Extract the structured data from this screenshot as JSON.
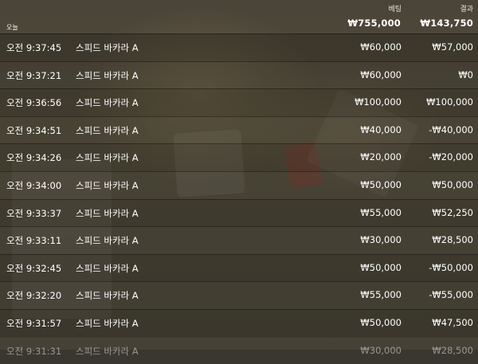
{
  "header": {
    "bet_label": "베팅",
    "result_label": "결과",
    "section_label": "오늘",
    "total_bet": "₩755,000",
    "total_result": "₩143,750"
  },
  "rows": [
    {
      "time": "오전 9:37:45",
      "game": "스피드 바카라 A",
      "bet": "₩60,000",
      "result": "₩57,000"
    },
    {
      "time": "오전 9:37:21",
      "game": "스피드 바카라 A",
      "bet": "₩60,000",
      "result": "₩0"
    },
    {
      "time": "오전 9:36:56",
      "game": "스피드 바카라 A",
      "bet": "₩100,000",
      "result": "₩100,000"
    },
    {
      "time": "오전 9:34:51",
      "game": "스피드 바카라 A",
      "bet": "₩40,000",
      "result": "-₩40,000"
    },
    {
      "time": "오전 9:34:26",
      "game": "스피드 바카라 A",
      "bet": "₩20,000",
      "result": "-₩20,000"
    },
    {
      "time": "오전 9:34:00",
      "game": "스피드 바카라 A",
      "bet": "₩50,000",
      "result": "₩50,000"
    },
    {
      "time": "오전 9:33:37",
      "game": "스피드 바카라 A",
      "bet": "₩55,000",
      "result": "₩52,250"
    },
    {
      "time": "오전 9:33:11",
      "game": "스피드 바카라 A",
      "bet": "₩30,000",
      "result": "₩28,500"
    },
    {
      "time": "오전 9:32:45",
      "game": "스피드 바카라 A",
      "bet": "₩50,000",
      "result": "-₩50,000"
    },
    {
      "time": "오전 9:32:20",
      "game": "스피드 바카라 A",
      "bet": "₩55,000",
      "result": "-₩55,000"
    },
    {
      "time": "오전 9:31:57",
      "game": "스피드 바카라 A",
      "bet": "₩50,000",
      "result": "₩47,500"
    },
    {
      "time": "오전 9:31:31",
      "game": "스피드 바카라 A",
      "bet": "₩30,000",
      "result": "₩28,500"
    }
  ]
}
